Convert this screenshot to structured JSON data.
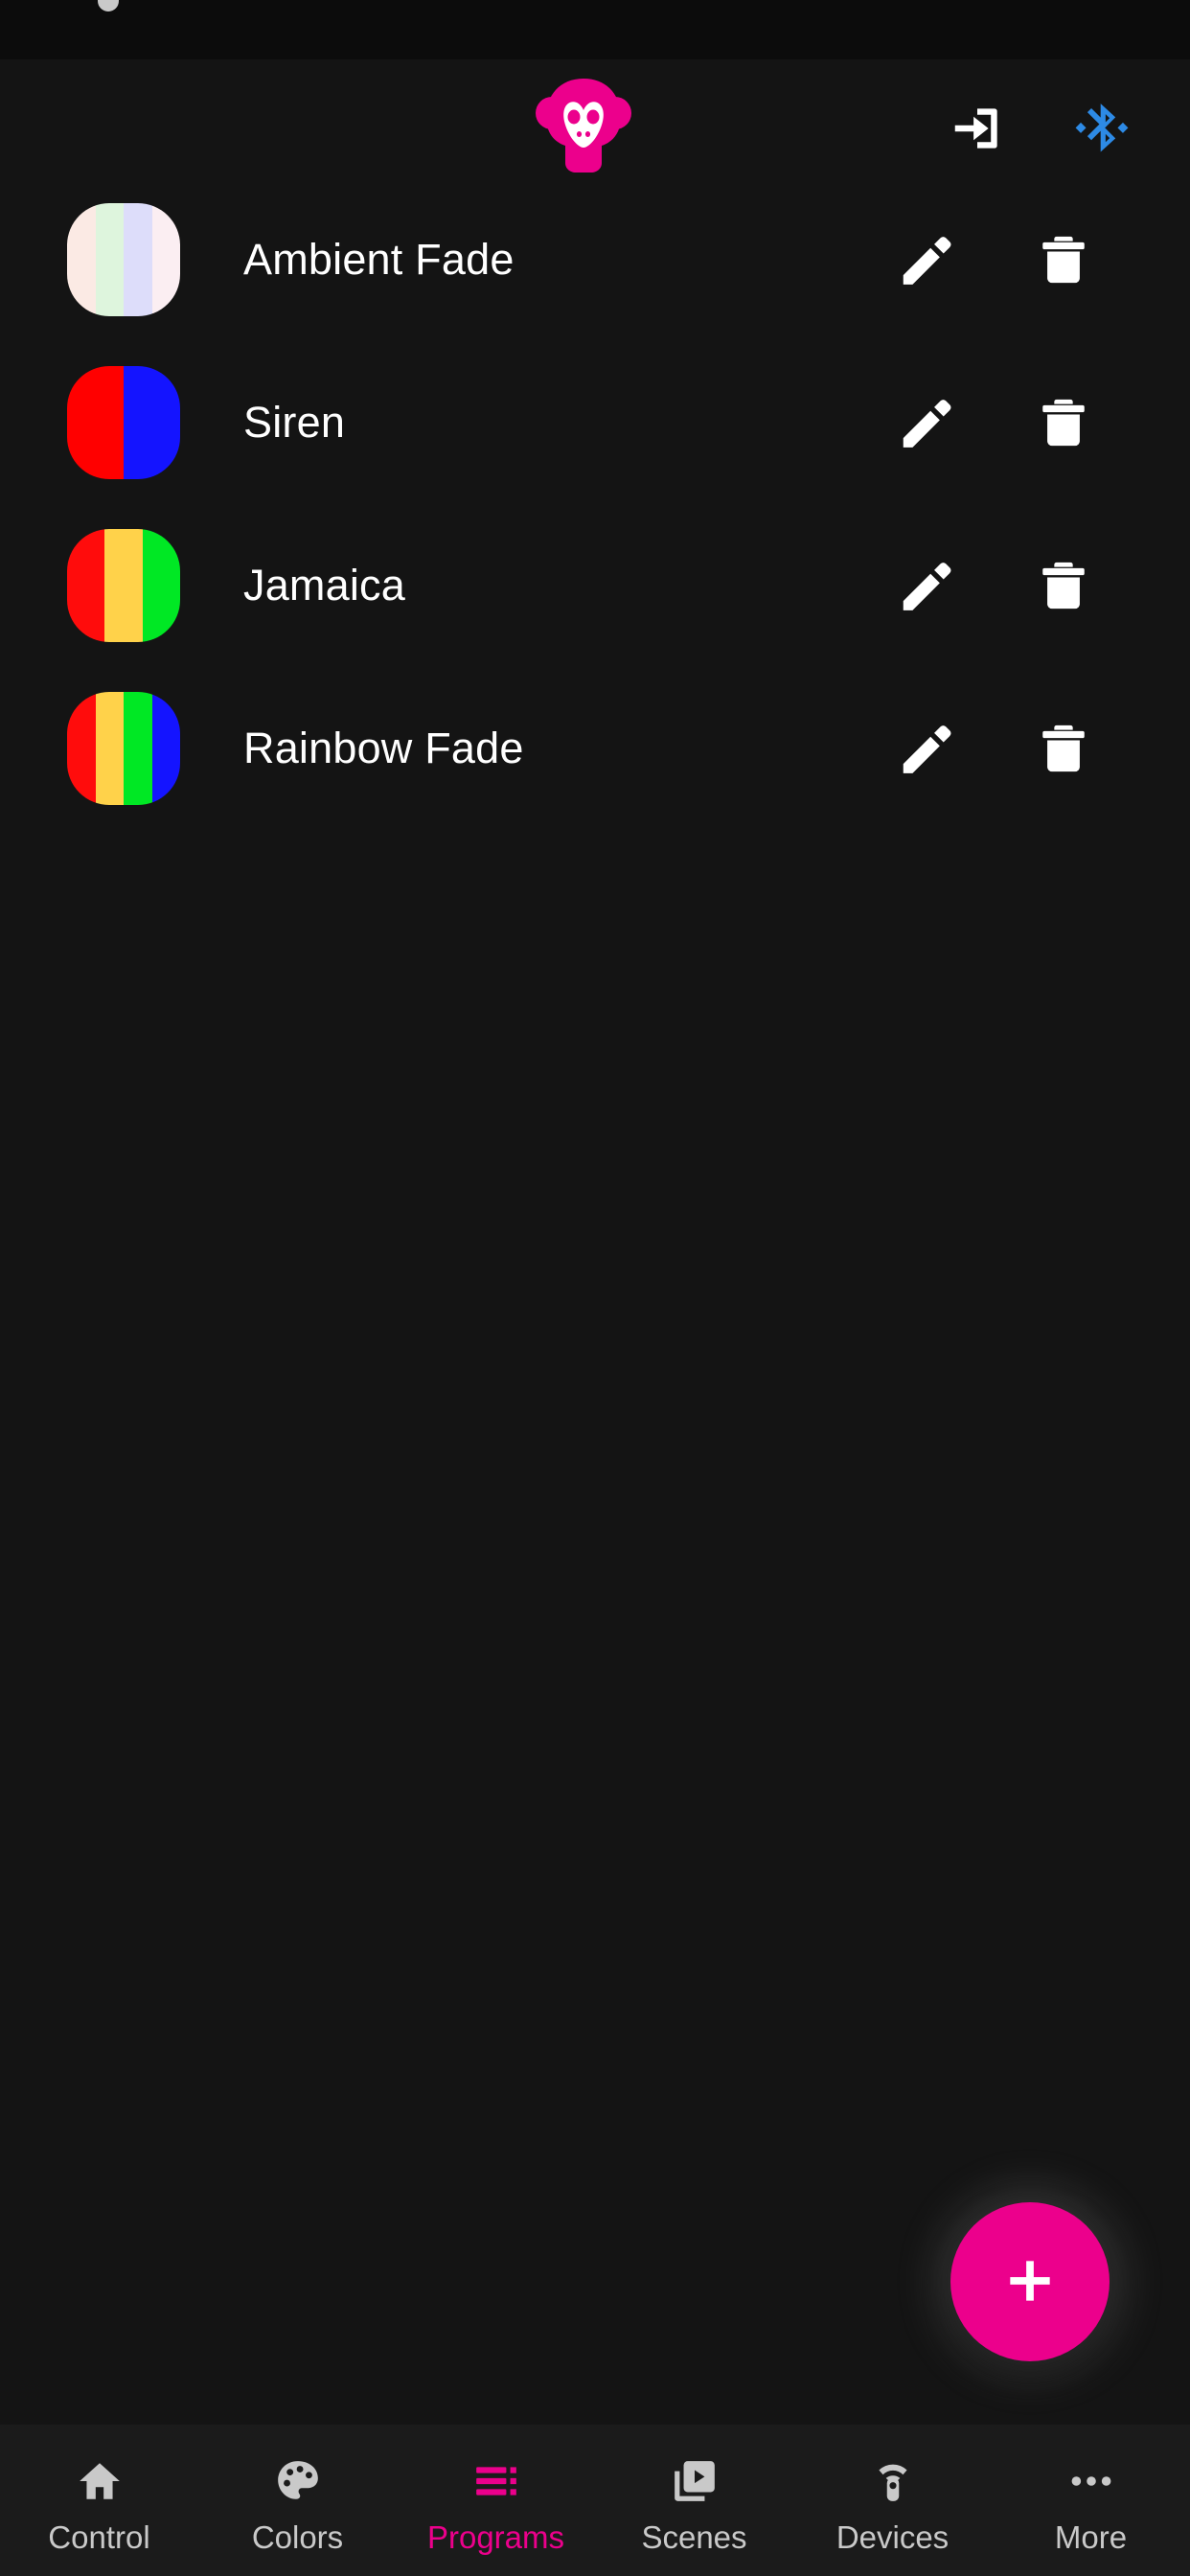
{
  "app": {
    "background": "#141414",
    "accent": "#EC008C",
    "bluetooth_color": "#2D8AE5",
    "logo_icon": "monkey-logo-icon"
  },
  "header": {
    "login_icon": "login-icon",
    "login_label": "Login",
    "bluetooth_icon": "bluetooth-icon",
    "bluetooth_label": "Bluetooth"
  },
  "programs": [
    {
      "name": "Ambient Fade",
      "colors": [
        "#FBEAE4",
        "#DEF5DD",
        "#DDDDFA",
        "#FBEEF2"
      ],
      "edit_icon": "edit-pencil-icon",
      "delete_icon": "delete-trash-icon"
    },
    {
      "name": "Siren",
      "colors": [
        "#FF0000",
        "#1414FF"
      ],
      "edit_icon": "edit-pencil-icon",
      "delete_icon": "delete-trash-icon"
    },
    {
      "name": "Jamaica",
      "colors": [
        "#FF0C0C",
        "#FFD24A",
        "#00E824"
      ],
      "edit_icon": "edit-pencil-icon",
      "delete_icon": "delete-trash-icon"
    },
    {
      "name": "Rainbow Fade",
      "colors": [
        "#FF0C0C",
        "#FFD24A",
        "#00E824",
        "#1414FF"
      ],
      "edit_icon": "edit-pencil-icon",
      "delete_icon": "delete-trash-icon"
    }
  ],
  "fab": {
    "label": "+",
    "icon": "plus-icon",
    "color": "#EC008C"
  },
  "bottom_nav": {
    "active_index": 2,
    "items": [
      {
        "label": "Control",
        "icon": "home-icon"
      },
      {
        "label": "Colors",
        "icon": "palette-icon"
      },
      {
        "label": "Programs",
        "icon": "playlist-icon"
      },
      {
        "label": "Scenes",
        "icon": "video-library-icon"
      },
      {
        "label": "Devices",
        "icon": "remote-signal-icon"
      },
      {
        "label": "More",
        "icon": "more-horizontal-icon"
      }
    ]
  }
}
